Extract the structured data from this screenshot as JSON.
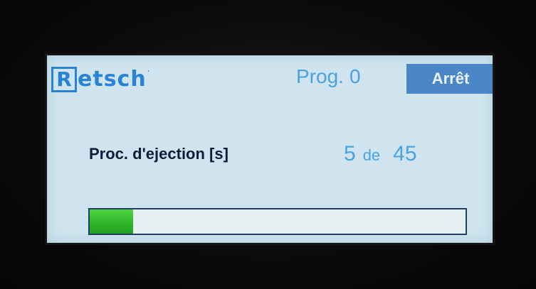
{
  "header": {
    "logo_letter": "R",
    "logo_text": "etsch",
    "program_label": "Prog.",
    "program_number": "0",
    "stop_button_label": "Arrêt"
  },
  "ejection": {
    "label": "Proc. d'ejection [s]",
    "current": "5",
    "separator": "de",
    "total": "45"
  },
  "progress": {
    "fraction": 0.115
  },
  "colors": {
    "screen_bg": "#cfe4ee",
    "accent_blue": "#4aa3e0",
    "button_bg": "#4a86c8",
    "progress_green": "#2eb52a"
  }
}
